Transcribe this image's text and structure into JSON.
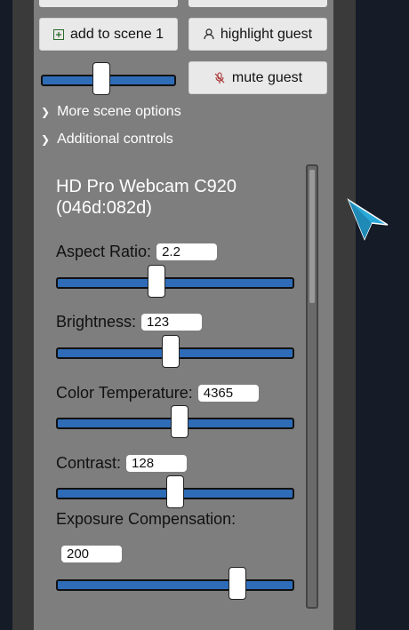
{
  "scene_buttons": {
    "add_to_scene": "add to scene 1",
    "highlight_guest": "highlight guest",
    "mute_guest": "mute guest"
  },
  "volume": {
    "level": 0.45
  },
  "disclosures": {
    "more_scene_options": "More scene options",
    "additional_controls": "Additional controls"
  },
  "device": {
    "title": "HD Pro Webcam C920 (046d:082d)"
  },
  "controls": [
    {
      "label": "Aspect Ratio:",
      "value": "2.2",
      "slider_fraction": 0.42
    },
    {
      "label": "Brightness:",
      "value": "123",
      "slider_fraction": 0.48
    },
    {
      "label": "Color Temperature:",
      "value": "4365",
      "slider_fraction": 0.52
    },
    {
      "label": "Contrast:",
      "value": "128",
      "slider_fraction": 0.5
    },
    {
      "label": "Exposure Compensation:",
      "value": "200",
      "slider_fraction": 0.76
    }
  ],
  "colors": {
    "slider_track": "#2e6cb8",
    "panel": "#7e7e7e",
    "background": "#151b27",
    "cursor": "#29a8d8"
  },
  "icons": {
    "add": "plus-square-icon",
    "highlight": "person-icon",
    "mute": "mic-off-icon",
    "disclosure": "chevron-right-icon"
  }
}
